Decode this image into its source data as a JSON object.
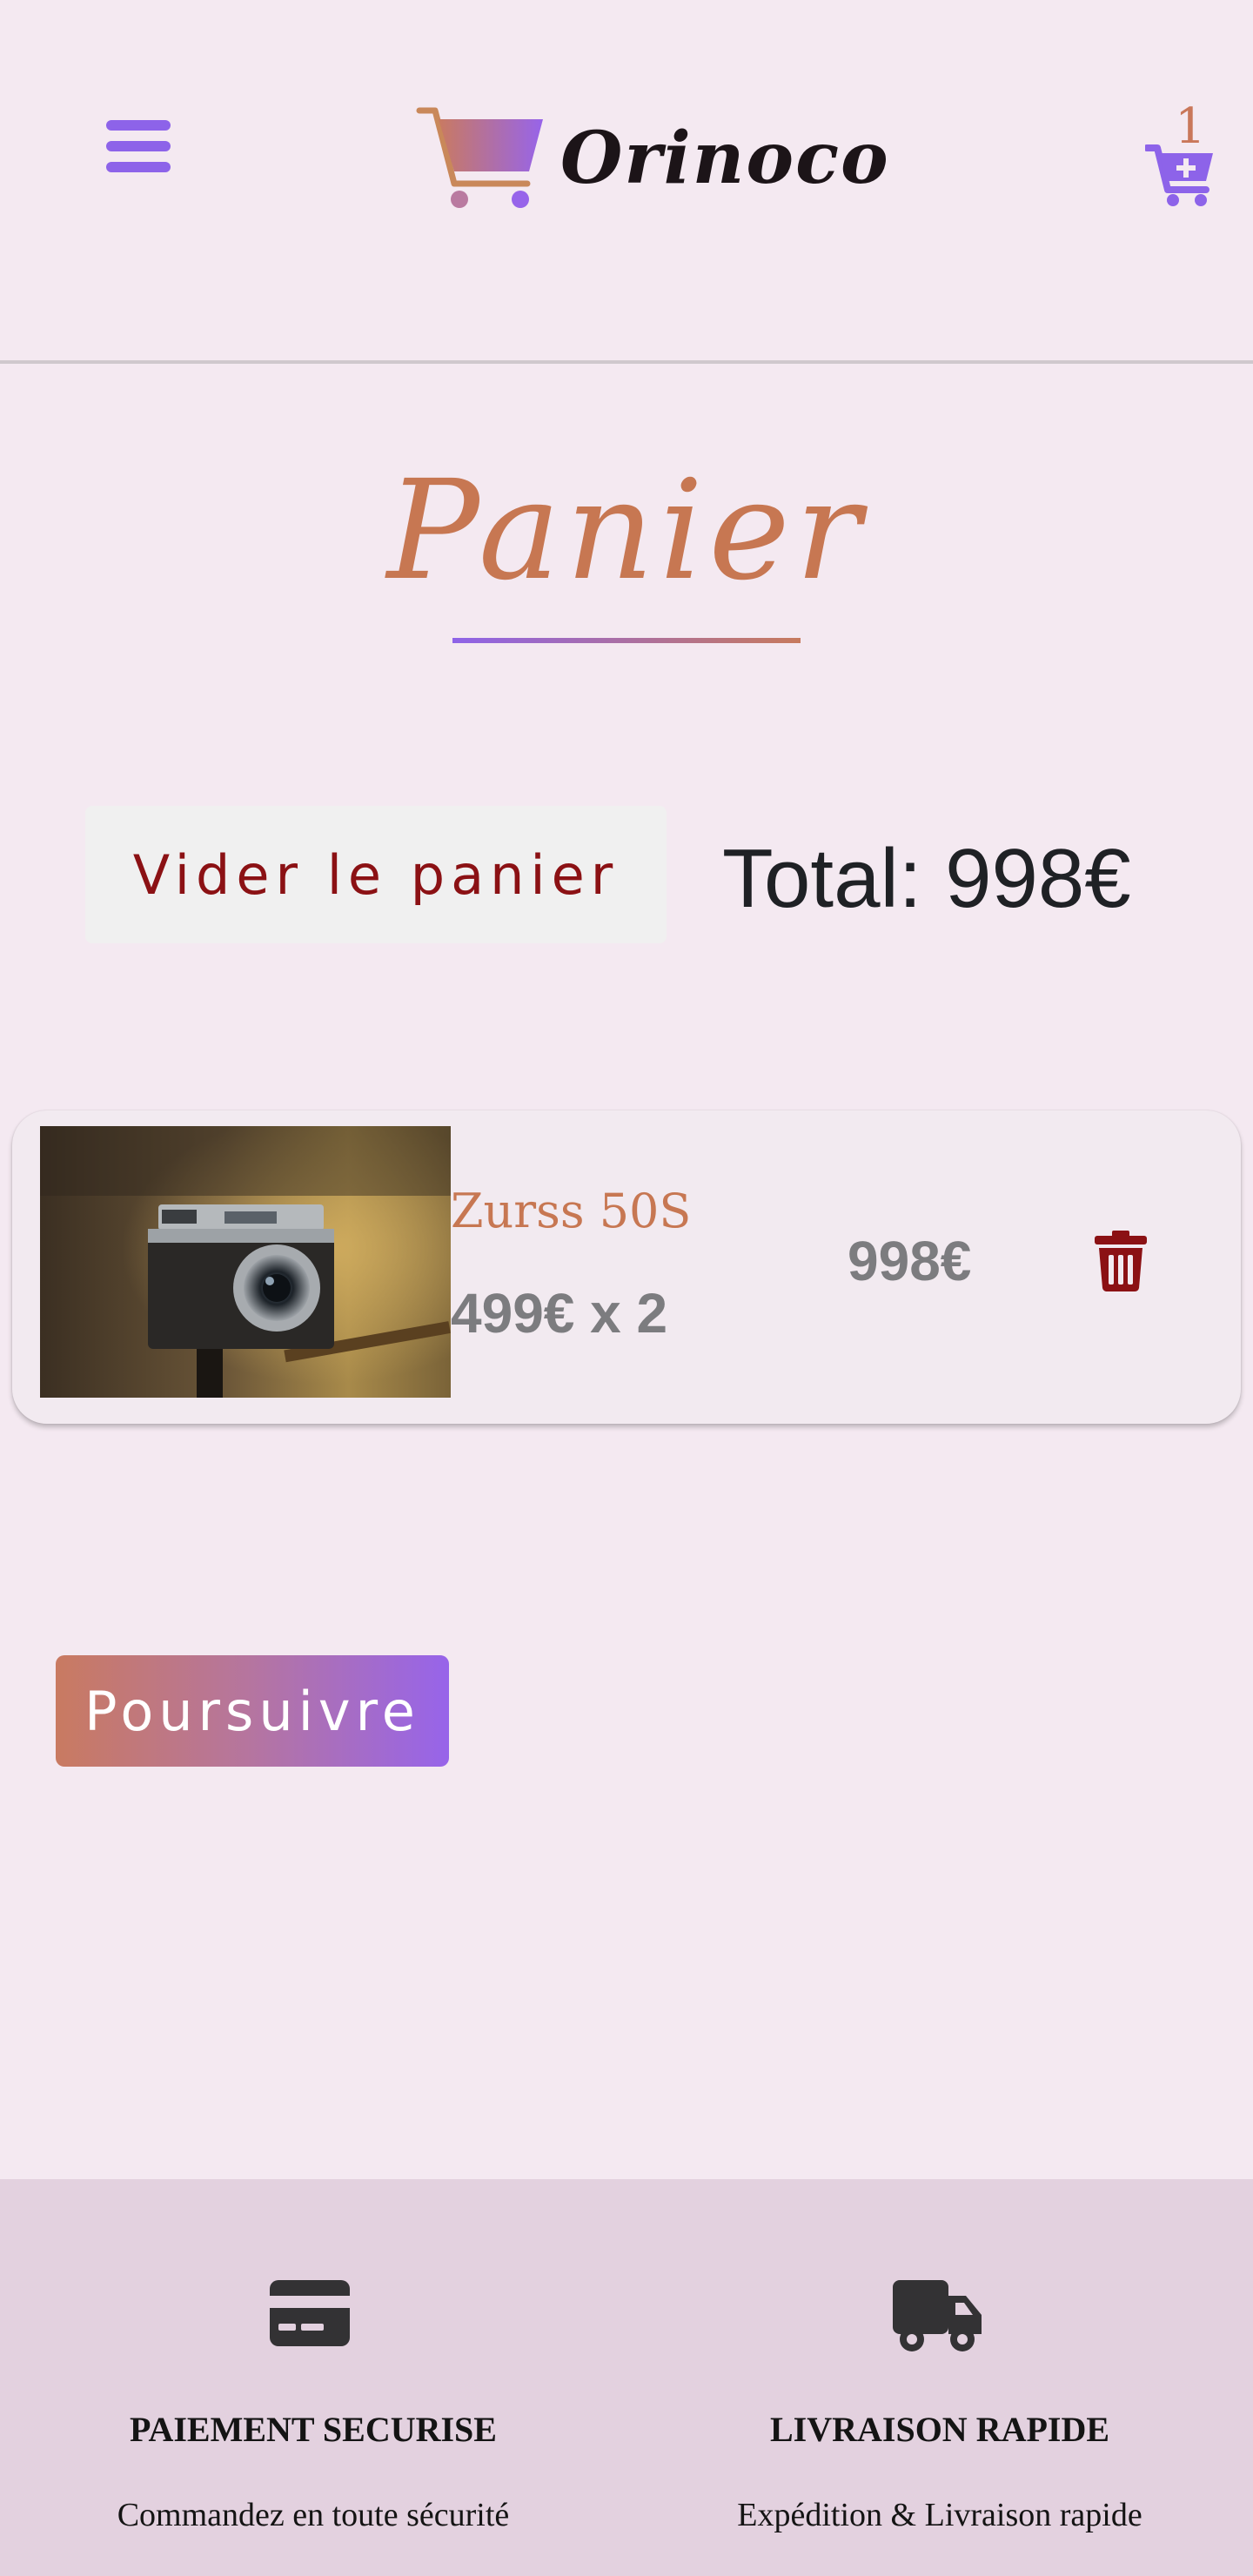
{
  "header": {
    "brand": "Orinoco",
    "cart_count": "1",
    "accent_color": "#8d63e9",
    "brand_gradient": [
      "#c97a61",
      "#9764ea"
    ]
  },
  "page": {
    "title": "Panier",
    "title_color": "#c77752"
  },
  "actions": {
    "empty_cart_label": "Vider le panier",
    "total_label": "Total: 998€"
  },
  "cart": {
    "items": [
      {
        "name": "Zurss 50S",
        "unit_line": "499€ x 2",
        "subtotal": "998€",
        "image": "camera-photo"
      }
    ]
  },
  "continue_label": "Poursuivre",
  "footer": {
    "features": [
      {
        "icon": "credit-card-icon",
        "title": "PAIEMENT SECURISE",
        "text": "Commandez en toute sécurité"
      },
      {
        "icon": "truck-icon",
        "title": "LIVRAISON RAPIDE",
        "text": "Expédition & Livraison rapide"
      }
    ]
  }
}
